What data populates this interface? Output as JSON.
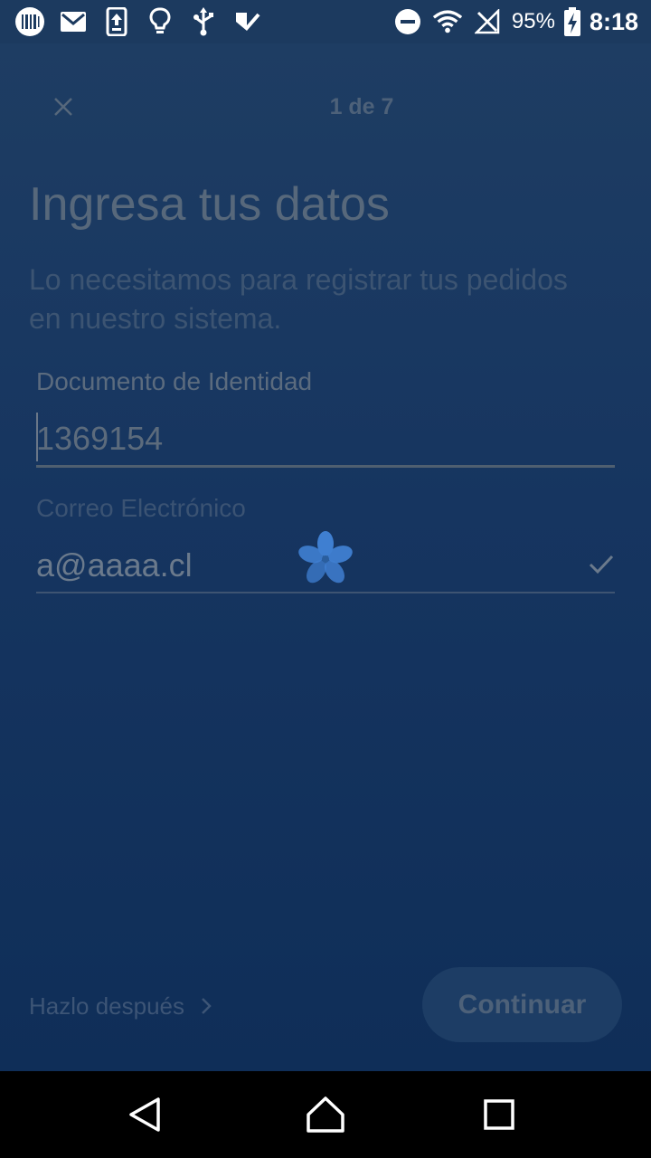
{
  "status_bar": {
    "battery_text": "95%",
    "time": "8:18",
    "icons": [
      "barcode-app-icon",
      "gmail-icon",
      "upload-icon",
      "lightbulb-icon",
      "usb-icon",
      "check-app-icon",
      "do-not-disturb-icon",
      "wifi-icon",
      "no-signal-icon",
      "battery-charging-icon"
    ]
  },
  "header": {
    "close_icon": "close-icon",
    "step": "1 de 7"
  },
  "main": {
    "title": "Ingresa tus datos",
    "subtitle": "Lo necesitamos para registrar tus pedidos en nuestro sistema.",
    "fields": {
      "document": {
        "label": "Documento de Identidad",
        "value": "1369154"
      },
      "email": {
        "label": "Correo Electrónico",
        "value": "a@aaaa.cl",
        "valid_icon": "check-icon"
      }
    },
    "loading_icon": "loading-spinner-icon"
  },
  "footer": {
    "later_label": "Hazlo después",
    "continue_label": "Continuar"
  },
  "nav_bar": {
    "icons": [
      "back-icon",
      "home-icon",
      "recents-icon"
    ]
  },
  "colors": {
    "background": "#16375e",
    "spinner": "#3f7fd1",
    "navbar": "#000000"
  }
}
